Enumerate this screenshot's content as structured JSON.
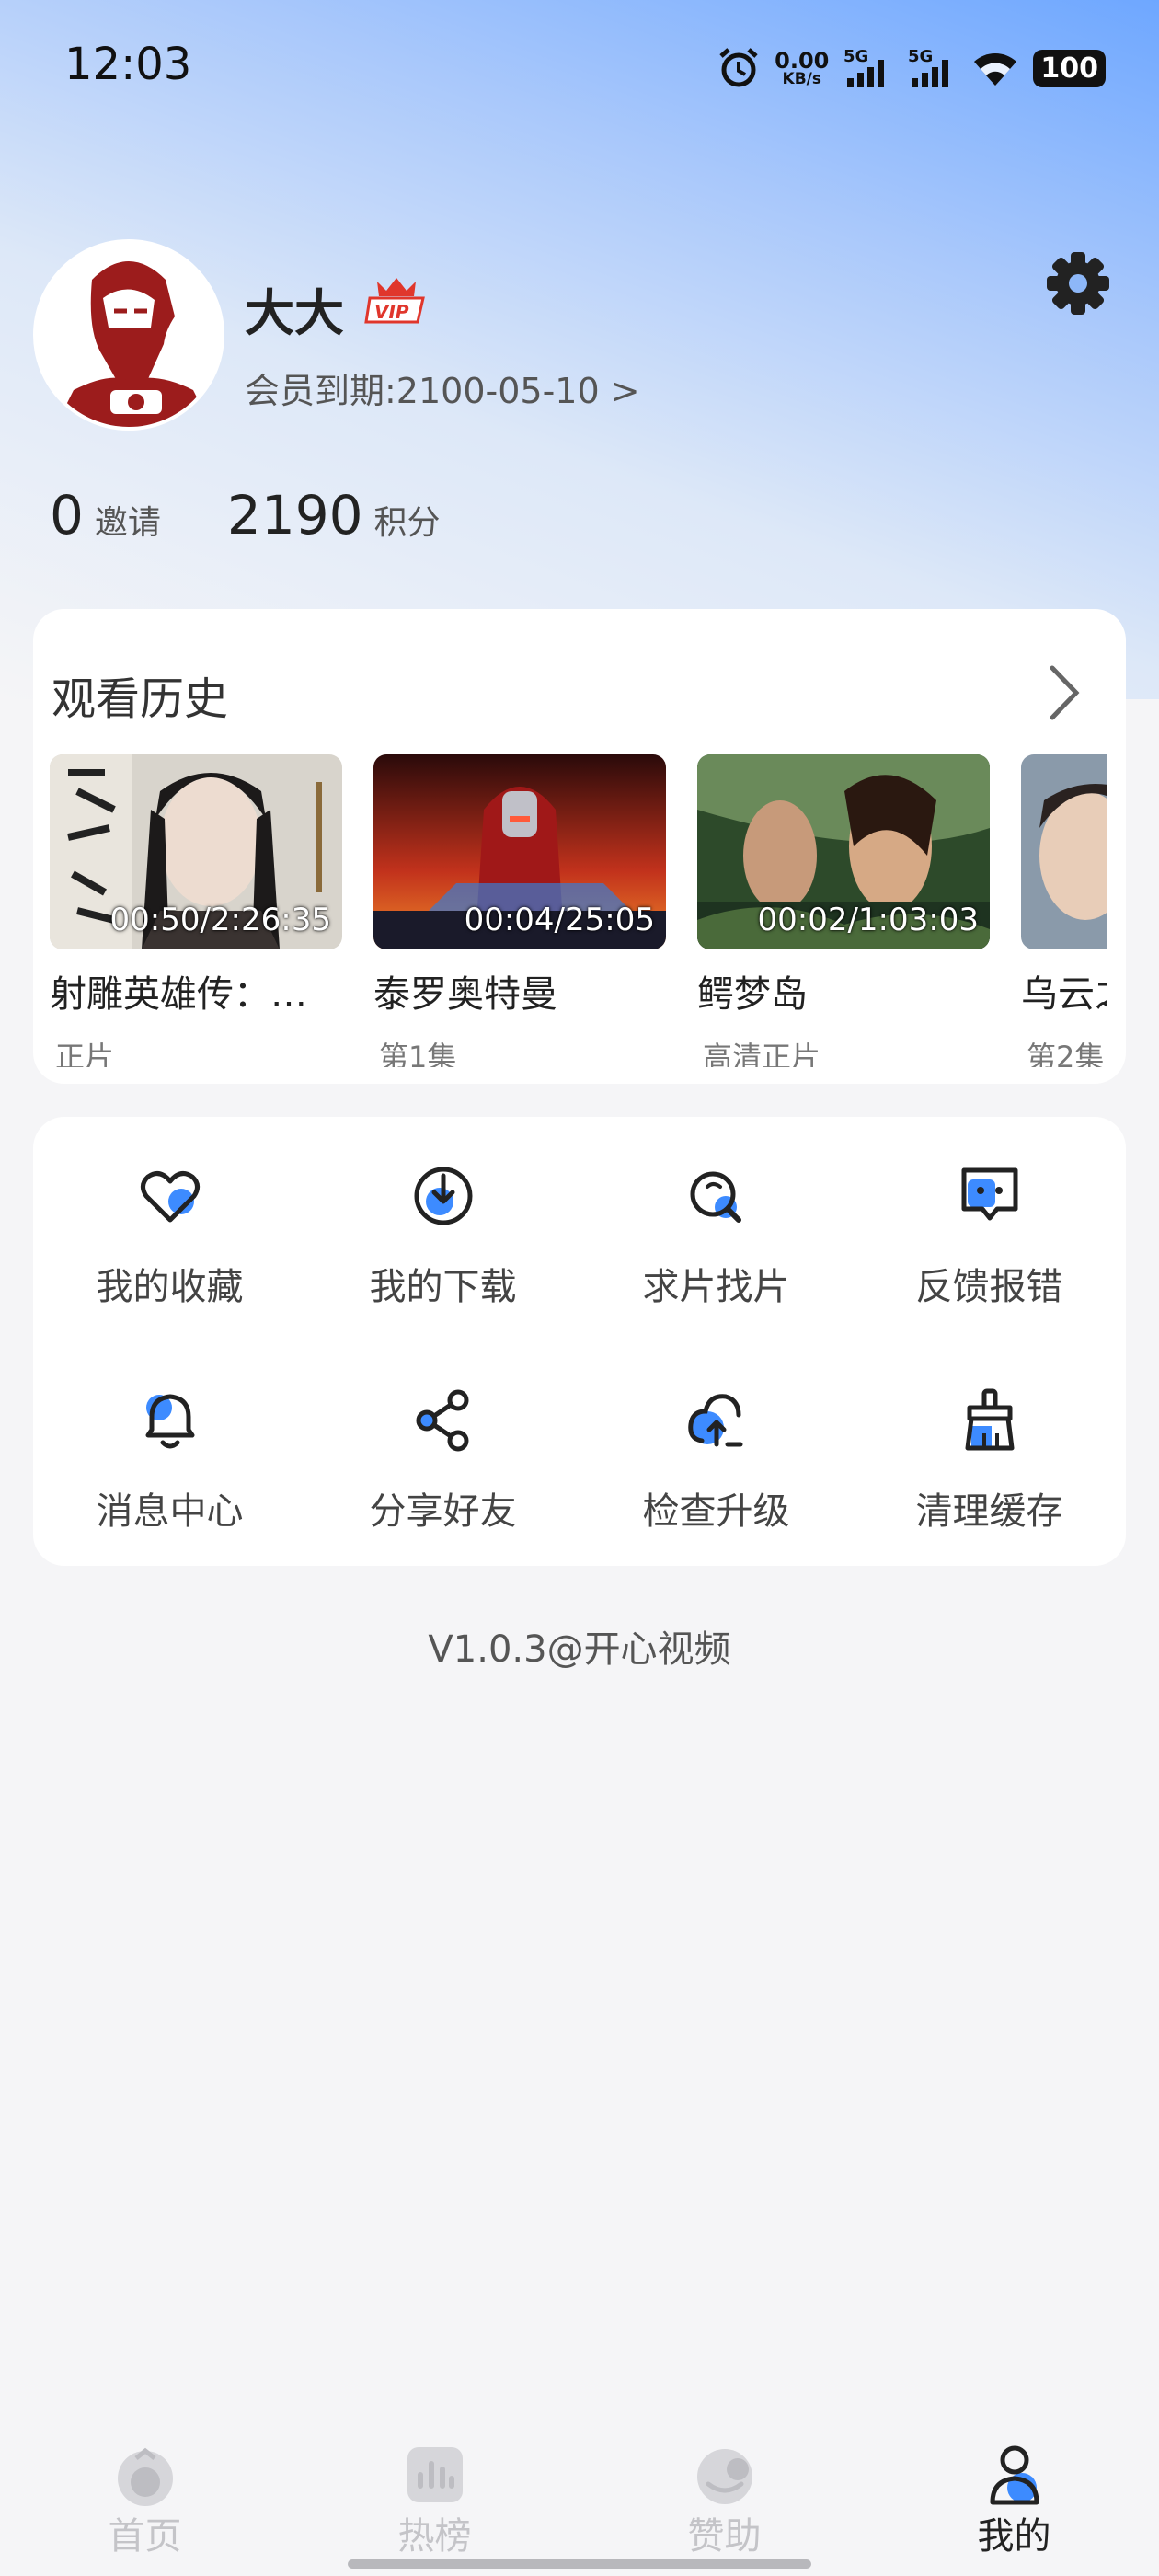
{
  "status_bar": {
    "time": "12:03",
    "net_speed_value": "0.00",
    "net_speed_unit": "KB/s",
    "signal1": "5G",
    "signal2": "5G",
    "battery": "100"
  },
  "profile": {
    "username": "大大",
    "vip_badge": "VIP",
    "member_expiry": "会员到期:2100-05-10 >",
    "stats": [
      {
        "value": "0",
        "label": "邀请"
      },
      {
        "value": "2190",
        "label": "积分"
      }
    ]
  },
  "history": {
    "title": "观看历史",
    "items": [
      {
        "title": "射雕英雄传：…",
        "subtitle": "正片",
        "progress": "00:50/2:26:35"
      },
      {
        "title": "泰罗奥特曼",
        "subtitle": "第1集",
        "progress": "00:04/25:05"
      },
      {
        "title": "鳄梦岛",
        "subtitle": "高清正片",
        "progress": "00:02/1:03:03"
      },
      {
        "title": "乌云之",
        "subtitle": "第2集",
        "progress": ""
      }
    ]
  },
  "functions": [
    {
      "label": "我的收藏",
      "icon": "heart-icon"
    },
    {
      "label": "我的下载",
      "icon": "download-icon"
    },
    {
      "label": "求片找片",
      "icon": "search-icon"
    },
    {
      "label": "反馈报错",
      "icon": "feedback-icon"
    },
    {
      "label": "消息中心",
      "icon": "bell-icon"
    },
    {
      "label": "分享好友",
      "icon": "share-icon"
    },
    {
      "label": "检查升级",
      "icon": "upgrade-icon"
    },
    {
      "label": "清理缓存",
      "icon": "brush-icon"
    }
  ],
  "version": "V1.0.3@开心视频",
  "nav": [
    {
      "label": "首页",
      "icon": "home-icon"
    },
    {
      "label": "热榜",
      "icon": "chart-icon"
    },
    {
      "label": "赞助",
      "icon": "sponsor-icon"
    },
    {
      "label": "我的",
      "icon": "profile-icon"
    }
  ],
  "colors": {
    "accent": "#3d8bff",
    "gradient_top": "#6ea7ff",
    "vip_red": "#e0362c",
    "avatar_red": "#9c1c1c"
  }
}
